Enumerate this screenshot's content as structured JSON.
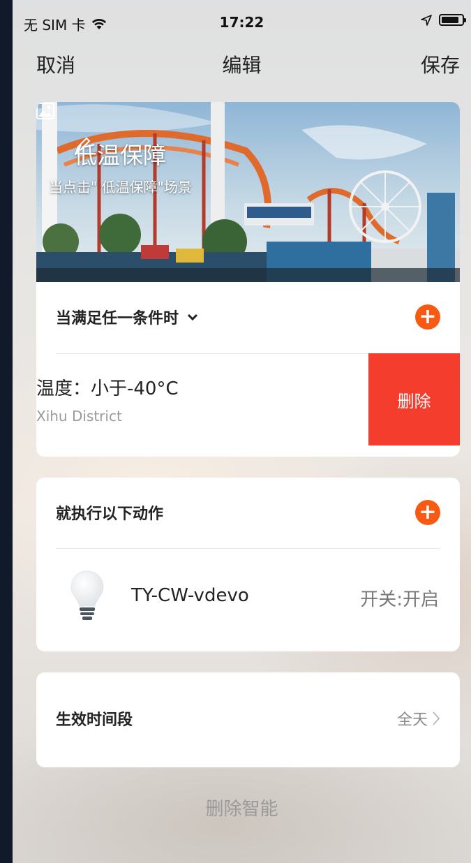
{
  "status_bar": {
    "carrier": "无 SIM 卡",
    "time": "17:22"
  },
  "nav": {
    "cancel": "取消",
    "title": "编辑",
    "save": "保存"
  },
  "scene": {
    "name": "低温保障",
    "description": "当点击\"  低温保障\"场景"
  },
  "conditions": {
    "header": "当满足任一条件时",
    "items": [
      {
        "title": "温度：小于-40°C",
        "subtitle": "Xihu District",
        "delete_label": "删除"
      }
    ]
  },
  "actions": {
    "header": "就执行以下动作",
    "items": [
      {
        "device": "TY-CW-vdevo",
        "state": "开关:开启",
        "icon": "light-bulb-icon"
      }
    ]
  },
  "effective_period": {
    "label": "生效时间段",
    "value": "全天"
  },
  "delete_smart": "删除智能",
  "colors": {
    "accent": "#f85a13",
    "danger": "#f43d2c"
  }
}
